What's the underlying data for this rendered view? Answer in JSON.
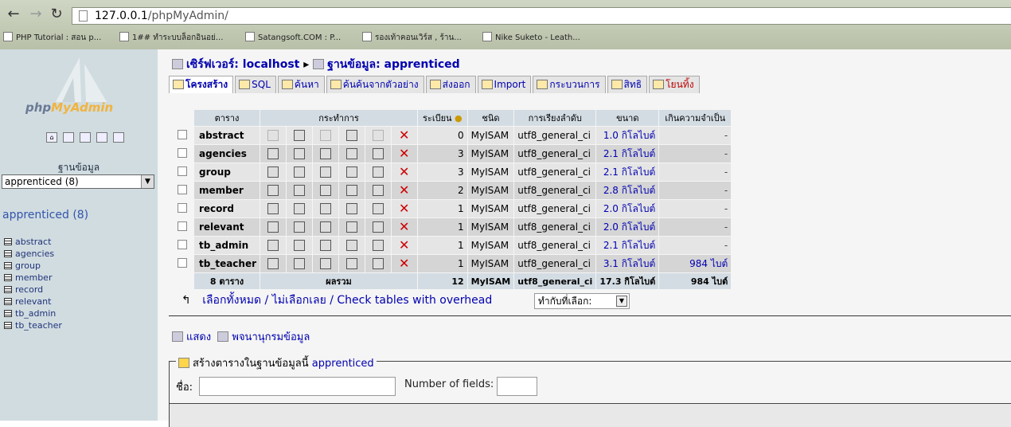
{
  "browser": {
    "url_host": "127.0.0.1",
    "url_path": "/phpMyAdmin/",
    "bookmarks": [
      "PHP Tutorial : สอน p...",
      "1## ทำระบบล็อกอินอย่...",
      "Satangsoft.COM : P...",
      "รองเท้าคอนเวิร์ส , ร้าน...",
      "Nike Suketo - Leath..."
    ]
  },
  "sidebar": {
    "logo_php": "php",
    "logo_my": "MyAdmin",
    "db_label": "ฐานข้อมูล",
    "db_selected": "apprenticed (8)",
    "db_heading": "apprenticed (8)",
    "tables": [
      "abstract",
      "agencies",
      "group",
      "member",
      "record",
      "relevant",
      "tb_admin",
      "tb_teacher"
    ]
  },
  "breadcrumb": {
    "server_label": "เซิร์ฟเวอร์: localhost",
    "sep": "▸",
    "db_label": "ฐานข้อมูล: apprenticed"
  },
  "tabs": [
    {
      "label": "โครงสร้าง",
      "active": true
    },
    {
      "label": "SQL"
    },
    {
      "label": "ค้นหา"
    },
    {
      "label": "ค้นค้นจากตัวอย่าง"
    },
    {
      "label": "ส่งออก"
    },
    {
      "label": "Import"
    },
    {
      "label": "กระบวนการ"
    },
    {
      "label": "สิทธิ"
    },
    {
      "label": "โยนทิ้ง"
    }
  ],
  "table": {
    "headers": {
      "table": "ตาราง",
      "actions": "กระทำการ",
      "records": "ระเบียน",
      "type": "ชนิด",
      "collation": "การเรียงลำดับ",
      "size": "ขนาด",
      "overhead": "เกินความจำเป็น"
    },
    "rows": [
      {
        "name": "abstract",
        "records": "0",
        "type": "MyISAM",
        "collation": "utf8_general_ci",
        "size": "1.0 กิโลไบต์",
        "overhead": "-",
        "empty": true
      },
      {
        "name": "agencies",
        "records": "3",
        "type": "MyISAM",
        "collation": "utf8_general_ci",
        "size": "2.1 กิโลไบต์",
        "overhead": "-"
      },
      {
        "name": "group",
        "records": "3",
        "type": "MyISAM",
        "collation": "utf8_general_ci",
        "size": "2.1 กิโลไบต์",
        "overhead": "-"
      },
      {
        "name": "member",
        "records": "2",
        "type": "MyISAM",
        "collation": "utf8_general_ci",
        "size": "2.8 กิโลไบต์",
        "overhead": "-"
      },
      {
        "name": "record",
        "records": "1",
        "type": "MyISAM",
        "collation": "utf8_general_ci",
        "size": "2.0 กิโลไบต์",
        "overhead": "-"
      },
      {
        "name": "relevant",
        "records": "1",
        "type": "MyISAM",
        "collation": "utf8_general_ci",
        "size": "2.0 กิโลไบต์",
        "overhead": "-"
      },
      {
        "name": "tb_admin",
        "records": "1",
        "type": "MyISAM",
        "collation": "utf8_general_ci",
        "size": "2.1 กิโลไบต์",
        "overhead": "-"
      },
      {
        "name": "tb_teacher",
        "records": "1",
        "type": "MyISAM",
        "collation": "utf8_general_ci",
        "size": "3.1 กิโลไบต์",
        "overhead": "984 ไบต์"
      }
    ],
    "summary": {
      "tables": "8 ตาราง",
      "total_label": "ผลรวม",
      "records": "12",
      "type": "MyISAM",
      "collation": "utf8_general_ci",
      "size": "17.3 กิโลไบต์",
      "overhead": "984 ไบต์"
    }
  },
  "selection": {
    "select_all": "เลือกทั้งหมด",
    "sep1": " / ",
    "unselect_all": "ไม่เลือกเลย",
    "sep2": " / ",
    "check_overhead": "Check tables with overhead",
    "with_selected": "ทำกับที่เลือก:"
  },
  "links": {
    "print_view": "แสดง",
    "data_dictionary": "พจนานุกรมข้อมูล"
  },
  "create": {
    "legend": "สร้างตารางในฐานข้อมูลนี้",
    "db": "apprenticed",
    "name_label": "ชื่อ:",
    "fields_label": "Number of fields:"
  }
}
